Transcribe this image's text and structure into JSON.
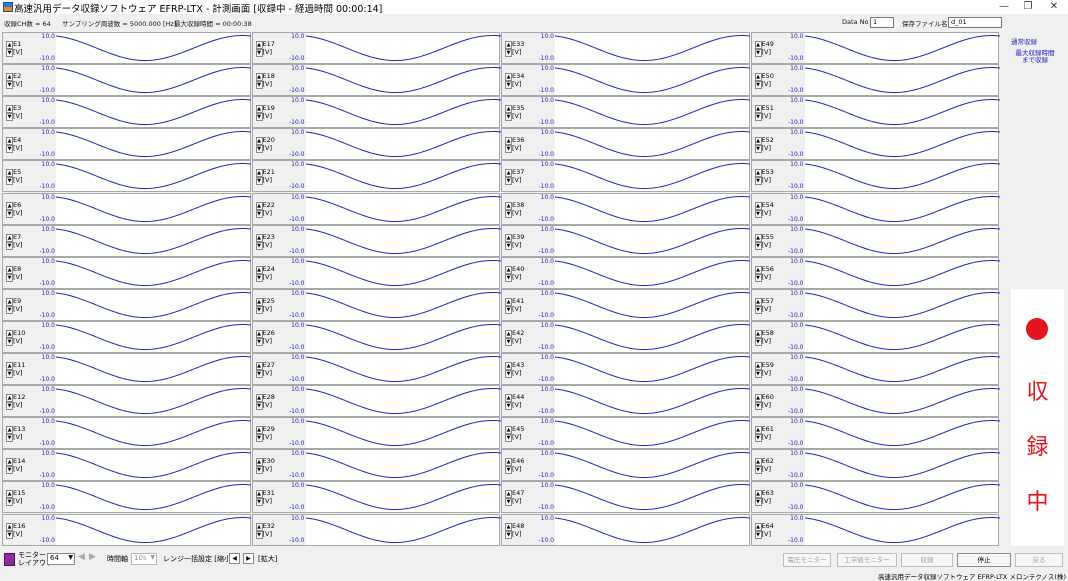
{
  "window": {
    "title": "高速汎用データ収録ソフトウェア EFRP-LTX - 計測画面 [収録中 - 経過時間 00:00:14]",
    "minimize": "—",
    "restore": "❐",
    "close": "✕"
  },
  "info": {
    "ch_count": "収録CH数 = 64",
    "sampling": "サンプリング周波数 = 5000.000 [Hz]",
    "max_time": "最大収録時間 = 00:00:38",
    "data_no_label": "Data No",
    "data_no_value": "1",
    "file_label": "保存ファイル名",
    "file_value": "d_01"
  },
  "channels": [
    {
      "name": "E1",
      "unit": "[V]",
      "max": "10.0",
      "min": "-10.0"
    },
    {
      "name": "E2",
      "unit": "[V]",
      "max": "10.0",
      "min": "-10.0"
    },
    {
      "name": "E3",
      "unit": "[V]",
      "max": "10.0",
      "min": "-10.0"
    },
    {
      "name": "E4",
      "unit": "[V]",
      "max": "10.0",
      "min": "-10.0"
    },
    {
      "name": "E5",
      "unit": "[V]",
      "max": "10.0",
      "min": "-10.0"
    },
    {
      "name": "E6",
      "unit": "[V]",
      "max": "10.0",
      "min": "-10.0"
    },
    {
      "name": "E7",
      "unit": "[V]",
      "max": "10.0",
      "min": "-10.0"
    },
    {
      "name": "E8",
      "unit": "[V]",
      "max": "10.0",
      "min": "-10.0"
    },
    {
      "name": "E9",
      "unit": "[V]",
      "max": "10.0",
      "min": "-10.0"
    },
    {
      "name": "E10",
      "unit": "[V]",
      "max": "10.0",
      "min": "-10.0"
    },
    {
      "name": "E11",
      "unit": "[V]",
      "max": "10.0",
      "min": "-10.0"
    },
    {
      "name": "E12",
      "unit": "[V]",
      "max": "10.0",
      "min": "-10.0"
    },
    {
      "name": "E13",
      "unit": "[V]",
      "max": "10.0",
      "min": "-10.0"
    },
    {
      "name": "E14",
      "unit": "[V]",
      "max": "10.0",
      "min": "-10.0"
    },
    {
      "name": "E15",
      "unit": "[V]",
      "max": "10.0",
      "min": "-10.0"
    },
    {
      "name": "E16",
      "unit": "[V]",
      "max": "10.0",
      "min": "-10.0"
    },
    {
      "name": "E17",
      "unit": "[V]",
      "max": "10.0",
      "min": "-10.0"
    },
    {
      "name": "E18",
      "unit": "[V]",
      "max": "10.0",
      "min": "-10.0"
    },
    {
      "name": "E19",
      "unit": "[V]",
      "max": "10.0",
      "min": "-10.0"
    },
    {
      "name": "E20",
      "unit": "[V]",
      "max": "10.0",
      "min": "-10.0"
    },
    {
      "name": "E21",
      "unit": "[V]",
      "max": "10.0",
      "min": "-10.0"
    },
    {
      "name": "E22",
      "unit": "[V]",
      "max": "10.0",
      "min": "-10.0"
    },
    {
      "name": "E23",
      "unit": "[V]",
      "max": "10.0",
      "min": "-10.0"
    },
    {
      "name": "E24",
      "unit": "[V]",
      "max": "10.0",
      "min": "-10.0"
    },
    {
      "name": "E25",
      "unit": "[V]",
      "max": "10.0",
      "min": "-10.0"
    },
    {
      "name": "E26",
      "unit": "[V]",
      "max": "10.0",
      "min": "-10.0"
    },
    {
      "name": "E27",
      "unit": "[V]",
      "max": "10.0",
      "min": "-10.0"
    },
    {
      "name": "E28",
      "unit": "[V]",
      "max": "10.0",
      "min": "-10.0"
    },
    {
      "name": "E29",
      "unit": "[V]",
      "max": "10.0",
      "min": "-10.0"
    },
    {
      "name": "E30",
      "unit": "[V]",
      "max": "10.0",
      "min": "-10.0"
    },
    {
      "name": "E31",
      "unit": "[V]",
      "max": "10.0",
      "min": "-10.0"
    },
    {
      "name": "E32",
      "unit": "[V]",
      "max": "10.0",
      "min": "-10.0"
    },
    {
      "name": "E33",
      "unit": "[V]",
      "max": "10.0",
      "min": "-10.0"
    },
    {
      "name": "E34",
      "unit": "[V]",
      "max": "10.0",
      "min": "-10.0"
    },
    {
      "name": "E35",
      "unit": "[V]",
      "max": "10.0",
      "min": "-10.0"
    },
    {
      "name": "E36",
      "unit": "[V]",
      "max": "10.0",
      "min": "-10.0"
    },
    {
      "name": "E37",
      "unit": "[V]",
      "max": "10.0",
      "min": "-10.0"
    },
    {
      "name": "E38",
      "unit": "[V]",
      "max": "10.0",
      "min": "-10.0"
    },
    {
      "name": "E39",
      "unit": "[V]",
      "max": "10.0",
      "min": "-10.0"
    },
    {
      "name": "E40",
      "unit": "[V]",
      "max": "10.0",
      "min": "-10.0"
    },
    {
      "name": "E41",
      "unit": "[V]",
      "max": "10.0",
      "min": "-10.0"
    },
    {
      "name": "E42",
      "unit": "[V]",
      "max": "10.0",
      "min": "-10.0"
    },
    {
      "name": "E43",
      "unit": "[V]",
      "max": "10.0",
      "min": "-10.0"
    },
    {
      "name": "E44",
      "unit": "[V]",
      "max": "10.0",
      "min": "-10.0"
    },
    {
      "name": "E45",
      "unit": "[V]",
      "max": "10.0",
      "min": "-10.0"
    },
    {
      "name": "E46",
      "unit": "[V]",
      "max": "10.0",
      "min": "-10.0"
    },
    {
      "name": "E47",
      "unit": "[V]",
      "max": "10.0",
      "min": "-10.0"
    },
    {
      "name": "E48",
      "unit": "[V]",
      "max": "10.0",
      "min": "-10.0"
    },
    {
      "name": "E49",
      "unit": "[V]",
      "max": "10.0",
      "min": "-10.0"
    },
    {
      "name": "E50",
      "unit": "[V]",
      "max": "10.0",
      "min": "-10.0"
    },
    {
      "name": "E51",
      "unit": "[V]",
      "max": "10.0",
      "min": "-10.0"
    },
    {
      "name": "E52",
      "unit": "[V]",
      "max": "10.0",
      "min": "-10.0"
    },
    {
      "name": "E53",
      "unit": "[V]",
      "max": "10.0",
      "min": "-10.0"
    },
    {
      "name": "E54",
      "unit": "[V]",
      "max": "10.0",
      "min": "-10.0"
    },
    {
      "name": "E55",
      "unit": "[V]",
      "max": "10.0",
      "min": "-10.0"
    },
    {
      "name": "E56",
      "unit": "[V]",
      "max": "10.0",
      "min": "-10.0"
    },
    {
      "name": "E57",
      "unit": "[V]",
      "max": "10.0",
      "min": "-10.0"
    },
    {
      "name": "E58",
      "unit": "[V]",
      "max": "10.0",
      "min": "-10.0"
    },
    {
      "name": "E59",
      "unit": "[V]",
      "max": "10.0",
      "min": "-10.0"
    },
    {
      "name": "E60",
      "unit": "[V]",
      "max": "10.0",
      "min": "-10.0"
    },
    {
      "name": "E61",
      "unit": "[V]",
      "max": "10.0",
      "min": "-10.0"
    },
    {
      "name": "E62",
      "unit": "[V]",
      "max": "10.0",
      "min": "-10.0"
    },
    {
      "name": "E63",
      "unit": "[V]",
      "max": "10.0",
      "min": "-10.0"
    },
    {
      "name": "E64",
      "unit": "[V]",
      "max": "10.0",
      "min": "-10.0"
    }
  ],
  "trace_color": "#1d25c8",
  "side": {
    "normal": "通常収録",
    "max_line1": "最大収録時間",
    "max_line2": "まで収録",
    "recording_chars": [
      "収",
      "録",
      "中"
    ],
    "recording_color": "#e4151b"
  },
  "bottom": {
    "monitor_line1": "モニター",
    "monitor_line2": "レイアウト",
    "layout_value": "64",
    "time_axis_label": "時間軸",
    "time_axis_value": "10s",
    "range_label": "レンジ一括設定 [縮小]",
    "zoom_label": "[拡大]",
    "buttons": {
      "voltage_monitor": "電圧モニター",
      "engineering_monitor": "工学値モニター",
      "record": "収録",
      "stop": "停止",
      "back": "戻る"
    }
  },
  "status": {
    "text": "高速汎用データ収録ソフトウェア EFRP-LTX メロンテクノス(株)"
  }
}
